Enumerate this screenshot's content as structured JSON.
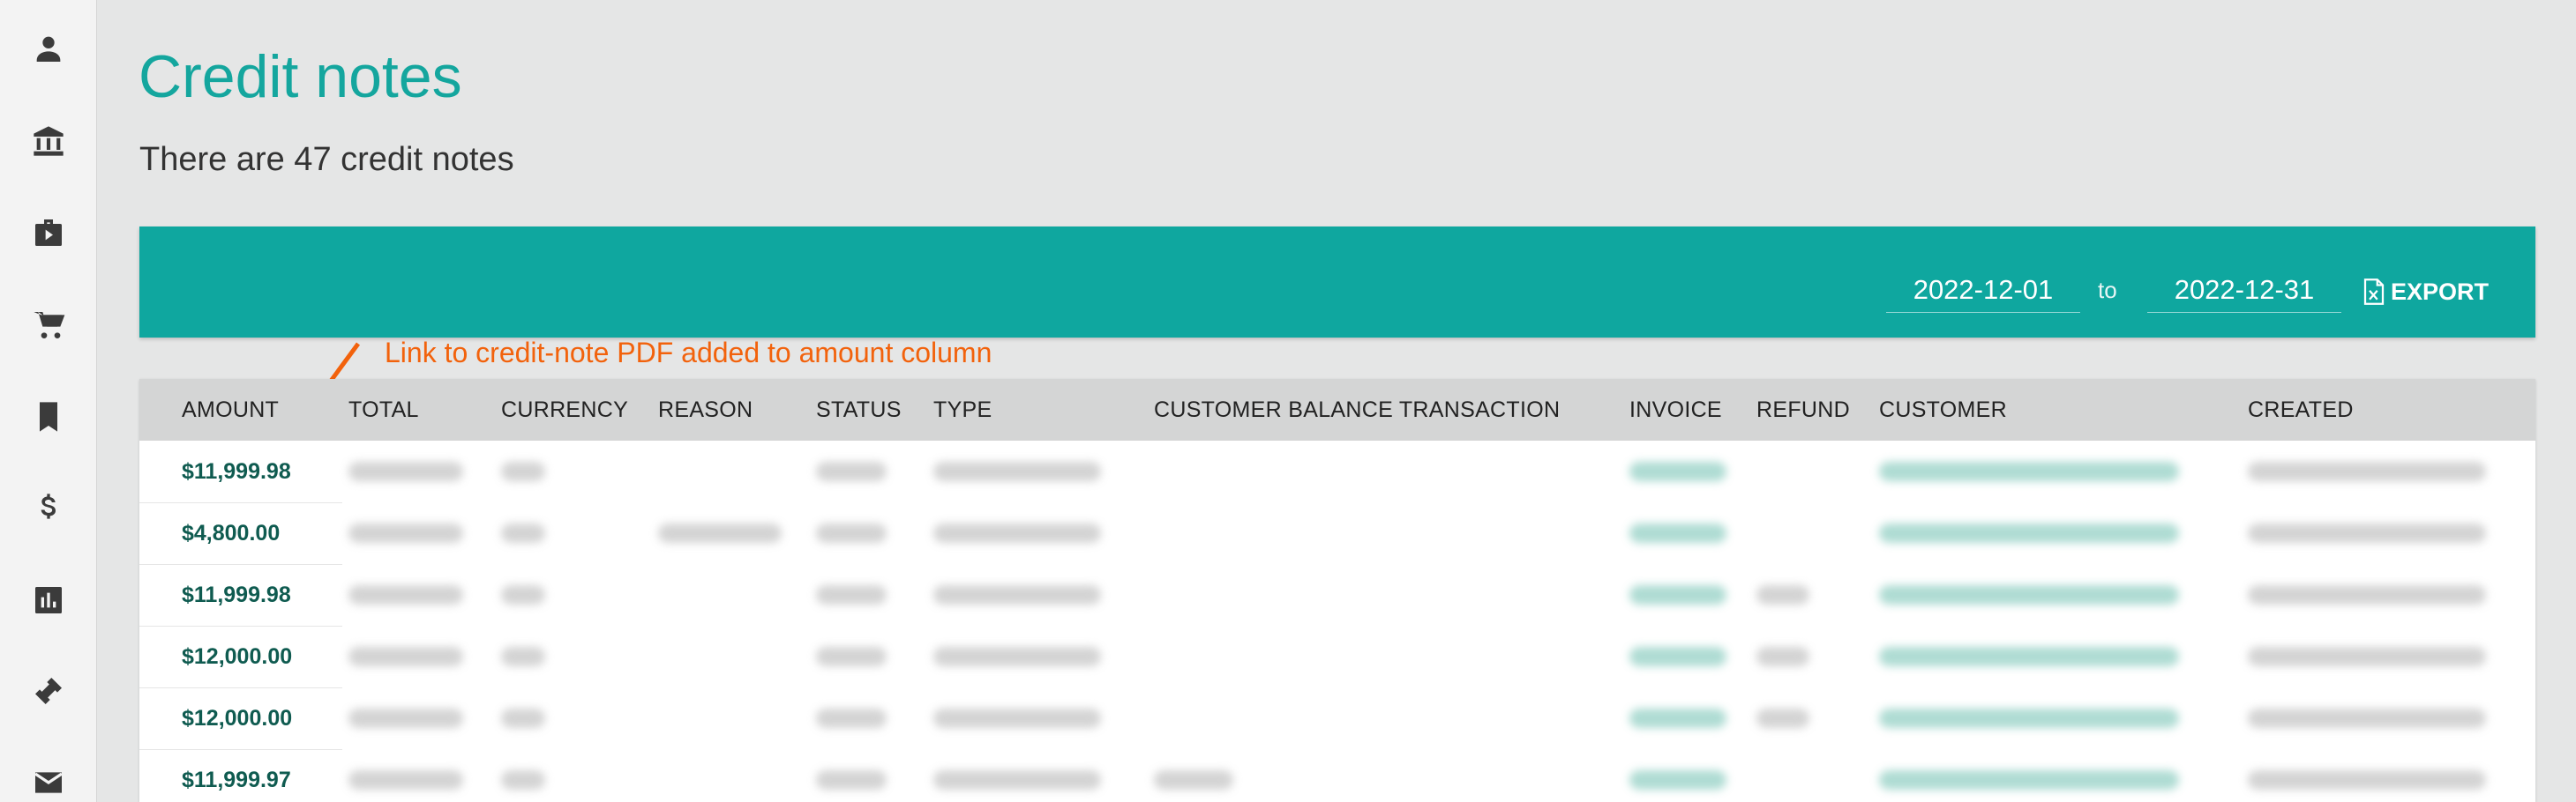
{
  "sidebar": {
    "items": [
      {
        "icon": "person-icon"
      },
      {
        "icon": "bank-icon"
      },
      {
        "icon": "briefcase-icon"
      },
      {
        "icon": "cart-icon"
      },
      {
        "icon": "bookmark-icon"
      },
      {
        "icon": "dollar-icon"
      },
      {
        "icon": "bar-chart-icon"
      },
      {
        "icon": "ticket-icon"
      },
      {
        "icon": "mail-icon"
      }
    ]
  },
  "page": {
    "title": "Credit notes",
    "subtitle": "There are 47 credit notes"
  },
  "toolbar": {
    "date_from": "2022-12-01",
    "to_label": "to",
    "date_to": "2022-12-31",
    "export_label": "EXPORT"
  },
  "annotation": {
    "text": "Link to credit-note PDF added to amount column",
    "color": "#f2620c"
  },
  "table": {
    "columns": [
      "AMOUNT",
      "TOTAL",
      "CURRENCY",
      "REASON",
      "STATUS",
      "TYPE",
      "CUSTOMER BALANCE TRANSACTION",
      "INVOICE",
      "REFUND",
      "CUSTOMER",
      "CREATED"
    ],
    "rows": [
      {
        "amount": "$11,999.98"
      },
      {
        "amount": "$4,800.00"
      },
      {
        "amount": "$11,999.98"
      },
      {
        "amount": "$12,000.00"
      },
      {
        "amount": "$12,000.00"
      },
      {
        "amount": "$11,999.97"
      }
    ]
  },
  "colors": {
    "accent": "#0fa79f",
    "title": "#14a69e",
    "amount_link": "#0f5b50"
  }
}
